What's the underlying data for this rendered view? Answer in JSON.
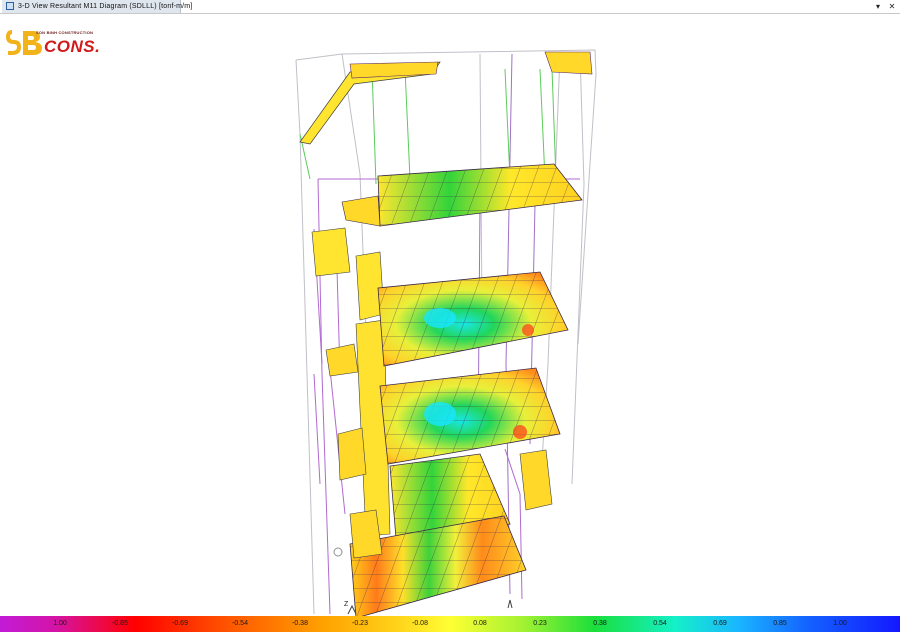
{
  "window": {
    "title": "3-D View   Resultant M11 Diagram   (SDLLL)  [tonf-m/m]",
    "dropdown_glyph": "▾",
    "close_glyph": "✕"
  },
  "logo": {
    "subtitle": "SON BINH CONSTRUCTION",
    "text": "CONS.",
    "brand_color": "#d11a1a",
    "accent_color": "#f2b21a"
  },
  "axes": {
    "z_label": "Z"
  },
  "legend": {
    "ticks": [
      "1.00",
      "-0.85",
      "-0.69",
      "-0.54",
      "-0.38",
      "-0.23",
      "-0.08",
      "0.08",
      "0.23",
      "0.38",
      "0.54",
      "0.69",
      "0.85",
      "1.00"
    ]
  }
}
